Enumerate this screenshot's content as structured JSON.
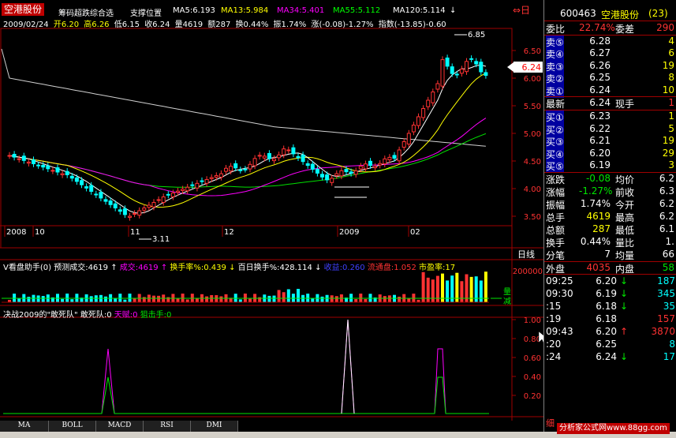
{
  "header": {
    "stock_name": "空港股份",
    "indicator_title": "筹码超跌综合选",
    "support_label": "支撑位置",
    "ma": [
      {
        "label": "MA5:6.193",
        "color": "#ffffff"
      },
      {
        "label": "MA13:5.984",
        "color": "#ffff00"
      },
      {
        "label": "MA34:5.401",
        "color": "#ff00ff"
      },
      {
        "label": "MA55:5.112",
        "color": "#00ff00"
      },
      {
        "label": "MA120:5.114",
        "color": "#ffffff"
      }
    ],
    "arrow_down_icon": "↓",
    "right_icons": "⇔日"
  },
  "info_line": {
    "date": "2009/02/24",
    "open": "开6.20",
    "high": "高6.26",
    "low": "低6.15",
    "close": "收6.24",
    "volume": "量4619",
    "amount": "额287",
    "turnover": "换0.44%",
    "amplitude": "振1.74%",
    "change": "涨(-0.08)-1.27%",
    "index": "指数(-13.85)-0.60"
  },
  "main_chart": {
    "y_ticks": [
      "6.50",
      "6.00",
      "5.50",
      "5.00",
      "4.50",
      "4.00",
      "3.50"
    ],
    "current_price_tag": "6.24",
    "high_label": "6.85",
    "low_label": "3.11",
    "x_labels": [
      "2008",
      "10",
      "11",
      "12",
      "2009",
      "02"
    ],
    "period_label": "日线"
  },
  "vol_bar": {
    "title": "V看盘助手(0)",
    "forecast": "预测成交:4619",
    "arrow": "↑",
    "deal": "成交:4619",
    "deal_arrow": "↑",
    "turnover": "换手率%:0.439",
    "turnover_arrow": "↓",
    "hundred_day": "百日换手%:428.114",
    "hundred_arrow": "↓",
    "income": "收益:0.260",
    "float": "流通盘:1.052",
    "pe": "市盈率:17",
    "axis_top": "200000",
    "legend_up": "量",
    "legend_down": "减"
  },
  "indicator": {
    "title": "决战2009的\"敢死队\"",
    "line1": "敢死队:0",
    "line2": "天赋:0",
    "line3": "狙击手:0",
    "y_ticks": [
      "1.00",
      "0.80",
      "0.60",
      "0.40",
      "0.20"
    ]
  },
  "bottom_tabs": [
    "MA",
    "BOLL",
    "MACD",
    "RSI",
    "DMI"
  ],
  "right_panel": {
    "code": "600463",
    "name": "空港股份",
    "count": "(23)",
    "ratio_label": "委比",
    "ratio_value": "22.74%",
    "diff_label": "委差",
    "diff_value": "290",
    "sells": [
      {
        "label": "卖⑤",
        "price": "6.28",
        "vol": "4"
      },
      {
        "label": "卖④",
        "price": "6.27",
        "vol": "6"
      },
      {
        "label": "卖③",
        "price": "6.26",
        "vol": "19"
      },
      {
        "label": "卖②",
        "price": "6.25",
        "vol": "8"
      },
      {
        "label": "卖①",
        "price": "6.24",
        "vol": "10"
      }
    ],
    "last_label": "最新",
    "last_value": "6.24",
    "hand_label": "现手",
    "hand_value": "1",
    "buys": [
      {
        "label": "买①",
        "price": "6.23",
        "vol": "1"
      },
      {
        "label": "买②",
        "price": "6.22",
        "vol": "5"
      },
      {
        "label": "买③",
        "price": "6.21",
        "vol": "19"
      },
      {
        "label": "买④",
        "price": "6.20",
        "vol": "29"
      },
      {
        "label": "买⑤",
        "price": "6.19",
        "vol": "3"
      }
    ],
    "stats": [
      {
        "l1": "涨跌",
        "v1": "-0.08",
        "l2": "均价",
        "v2": "6.2"
      },
      {
        "l1": "涨幅",
        "v1": "-1.27%",
        "l2": "前收",
        "v2": "6.3"
      },
      {
        "l1": "振幅",
        "v1": "1.74%",
        "l2": "今开",
        "v2": "6.2"
      },
      {
        "l1": "总手",
        "v1": "4619",
        "l2": "最高",
        "v2": "6.2"
      },
      {
        "l1": "总额",
        "v1": "287",
        "l2": "最低",
        "v2": "6.1"
      },
      {
        "l1": "换手",
        "v1": "0.44%",
        "l2": "量比",
        "v2": "1."
      },
      {
        "l1": "分笔",
        "v1": "7",
        "l2": "均量",
        "v2": "66"
      }
    ],
    "outer_label": "外盘",
    "outer_value": "4035",
    "inner_label": "内盘",
    "inner_value": "58",
    "ticks": [
      {
        "time": "09:25",
        "price": "6.20",
        "arrow": "↓",
        "qty": "187"
      },
      {
        "time": "09:30",
        "price": "6.19",
        "arrow": "↓",
        "qty": "345"
      },
      {
        "time": ":15",
        "price": "6.18",
        "arrow": "↓",
        "qty": "35"
      },
      {
        "time": ":19",
        "price": "6.18",
        "arrow": "",
        "qty": "157"
      },
      {
        "time": "09:43",
        "price": "6.20",
        "arrow": "↑",
        "qty": "3870"
      },
      {
        "time": ":20",
        "price": "6.25",
        "arrow": "",
        "qty": "8"
      },
      {
        "time": ":24",
        "price": "6.24",
        "arrow": "↓",
        "qty": "17"
      }
    ],
    "side_tab": "细"
  },
  "watermark": "分析家公式网www.88gg.com"
}
